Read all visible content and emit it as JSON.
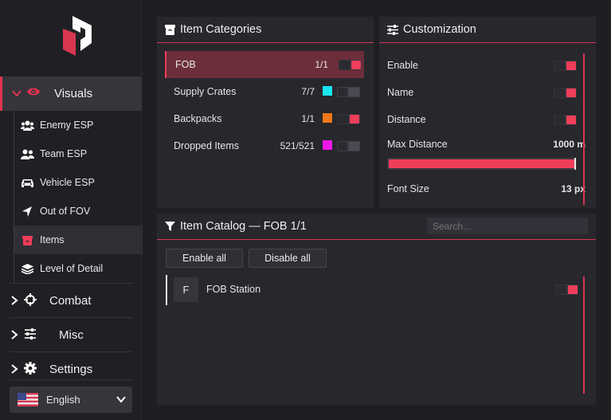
{
  "sidebar": {
    "visuals": "Visuals",
    "sub_items": [
      {
        "label": "Enemy ESP",
        "icon": "users-icon"
      },
      {
        "label": "Team ESP",
        "icon": "team-icon"
      },
      {
        "label": "Vehicle ESP",
        "icon": "car-icon"
      },
      {
        "label": "Out of FOV",
        "icon": "arrow-icon"
      },
      {
        "label": "Items",
        "icon": "box-icon"
      },
      {
        "label": "Level of Detail",
        "icon": "layers-icon"
      }
    ],
    "combat": "Combat",
    "misc": "Misc",
    "settings": "Settings",
    "language": "English"
  },
  "categories": {
    "title": "Item Categories",
    "rows": [
      {
        "name": "FOB",
        "count": "1/1",
        "enabled": true,
        "color": ""
      },
      {
        "name": "Supply Crates",
        "count": "7/7",
        "enabled": false,
        "color": "#19e6f0"
      },
      {
        "name": "Backpacks",
        "count": "1/1",
        "enabled": true,
        "color": "#f07818"
      },
      {
        "name": "Dropped Items",
        "count": "521/521",
        "enabled": false,
        "color": "#f018e6"
      }
    ]
  },
  "customization": {
    "title": "Customization",
    "enable_label": "Enable",
    "name_label": "Name",
    "distance_label": "Distance",
    "max_distance_label": "Max Distance",
    "max_distance_value": "1000 m",
    "max_distance_fraction": 1.0,
    "font_size_label": "Font Size",
    "font_size_value": "13 px"
  },
  "catalog": {
    "title": "Item Catalog — FOB  1/1",
    "search_placeholder": "Search...",
    "enable_all": "Enable all",
    "disable_all": "Disable all",
    "items": [
      {
        "badge": "F",
        "name": "FOB Station",
        "enabled": true
      }
    ]
  },
  "colors": {
    "accent": "#ef3e5a",
    "background": "#1f1f23",
    "panel": "#27272c"
  }
}
